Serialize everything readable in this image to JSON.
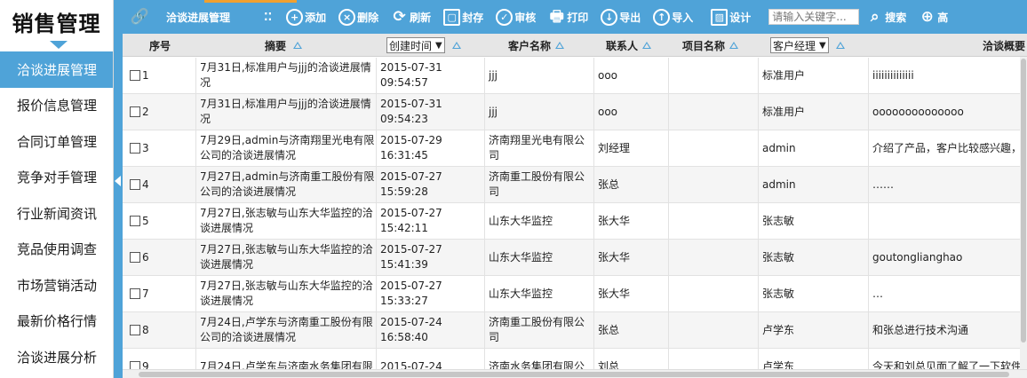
{
  "sidebar": {
    "title": "销售管理",
    "items": [
      {
        "label": "洽谈进展管理",
        "active": true
      },
      {
        "label": "报价信息管理",
        "active": false
      },
      {
        "label": "合同订单管理",
        "active": false
      },
      {
        "label": "竞争对手管理",
        "active": false
      },
      {
        "label": "行业新闻资讯",
        "active": false
      },
      {
        "label": "竞品使用调查",
        "active": false
      },
      {
        "label": "市场营销活动",
        "active": false
      },
      {
        "label": "最新价格行情",
        "active": false
      },
      {
        "label": "洽谈进展分析",
        "active": false
      }
    ]
  },
  "toolbar": {
    "module_title": "洽谈进展管理",
    "add": "添加",
    "delete": "删除",
    "refresh": "刷新",
    "seal": "封存",
    "review": "审核",
    "print": "打印",
    "export": "导出",
    "import": "导入",
    "design": "设计",
    "search_placeholder": "请输入关键字...",
    "search": "搜索",
    "advanced": "高"
  },
  "grid": {
    "headers": {
      "seq": "序号",
      "summary": "摘要",
      "created_time": "创建时间",
      "customer": "客户名称",
      "contact": "联系人",
      "project": "项目名称",
      "manager": "客户经理",
      "overview": "洽谈概要"
    },
    "rows": [
      {
        "seq": "1",
        "summary": "7月31日,标准用户与jjj的洽谈进展情况",
        "date": "2015-07-31",
        "time": "09:54:57",
        "customer": "jjj",
        "contact": "ooo",
        "project": "",
        "manager": "标准用户",
        "overview": "iiiiiiiiiiiiii"
      },
      {
        "seq": "2",
        "summary": "7月31日,标准用户与jjj的洽谈进展情况",
        "date": "2015-07-31",
        "time": "09:54:23",
        "customer": "jjj",
        "contact": "ooo",
        "project": "",
        "manager": "标准用户",
        "overview": "oooooooooooooo"
      },
      {
        "seq": "3",
        "summary": "7月29日,admin与济南翔里光电有限公司的洽谈进展情况",
        "date": "2015-07-29",
        "time": "16:31:45",
        "customer": "济南翔里光电有限公司",
        "contact": "刘经理",
        "project": "",
        "manager": "admin",
        "overview": "介绍了产品，客户比较感兴趣，"
      },
      {
        "seq": "4",
        "summary": "7月27日,admin与济南重工股份有限公司的洽谈进展情况",
        "date": "2015-07-27",
        "time": "15:59:28",
        "customer": "济南重工股份有限公司",
        "contact": "张总",
        "project": "",
        "manager": "admin",
        "overview": "……"
      },
      {
        "seq": "5",
        "summary": "7月27日,张志敏与山东大华监控的洽谈进展情况",
        "date": "2015-07-27",
        "time": "15:42:11",
        "customer": "山东大华监控",
        "contact": "张大华",
        "project": "",
        "manager": "张志敏",
        "overview": ""
      },
      {
        "seq": "6",
        "summary": "7月27日,张志敏与山东大华监控的洽谈进展情况",
        "date": "2015-07-27",
        "time": "15:41:39",
        "customer": "山东大华监控",
        "contact": "张大华",
        "project": "",
        "manager": "张志敏",
        "overview": "goutonglianghao"
      },
      {
        "seq": "7",
        "summary": "7月27日,张志敏与山东大华监控的洽谈进展情况",
        "date": "2015-07-27",
        "time": "15:33:27",
        "customer": "山东大华监控",
        "contact": "张大华",
        "project": "",
        "manager": "张志敏",
        "overview": "…"
      },
      {
        "seq": "8",
        "summary": "7月24日,卢学东与济南重工股份有限公司的洽谈进展情况",
        "date": "2015-07-24",
        "time": "16:58:40",
        "customer": "济南重工股份有限公司",
        "contact": "张总",
        "project": "",
        "manager": "卢学东",
        "overview": "和张总进行技术沟通"
      },
      {
        "seq": "9",
        "summary": "7月24日,卢学东与济南水务集团有限",
        "date": "2015-07-24",
        "time": "",
        "customer": "济南水务集团有限公",
        "contact": "刘总",
        "project": "",
        "manager": "卢学东",
        "overview": "今天和刘总见面了解了一下软件"
      }
    ]
  },
  "colors": {
    "accent": "#4fa3d8",
    "toolbar_accent": "#f0a030"
  }
}
